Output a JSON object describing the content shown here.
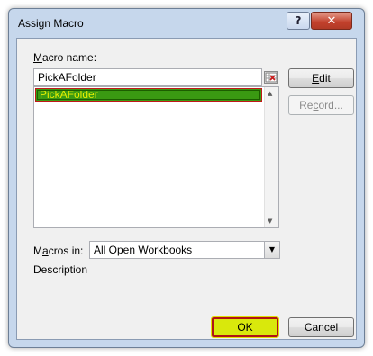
{
  "window": {
    "title": "Assign Macro",
    "help_glyph": "?",
    "close_glyph": "✕"
  },
  "macro_name": {
    "label_accel": "M",
    "label_rest": "acro name:",
    "value": "PickAFolder"
  },
  "macro_list": {
    "items": [
      "PickAFolder"
    ],
    "selected_index": 0
  },
  "buttons": {
    "edit_accel": "E",
    "edit_rest": "dit",
    "record_accel": "c",
    "record_pre": "Re",
    "record_post": "ord...",
    "ok": "OK",
    "cancel": "Cancel"
  },
  "macros_in": {
    "label_pre": "M",
    "label_accel": "a",
    "label_post": "cros in:",
    "selected": "All Open Workbooks"
  },
  "description": {
    "label": "Description"
  },
  "colors": {
    "highlight_fill": "#3a9a12",
    "highlight_text": "#e6ec00",
    "ok_fill": "#d9e80c",
    "annotation_border": "#b01414"
  }
}
